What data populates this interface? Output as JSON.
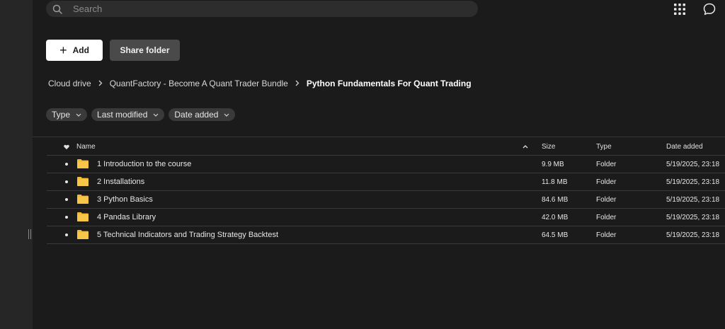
{
  "search": {
    "placeholder": "Search"
  },
  "toolbar": {
    "add_label": "Add",
    "share_label": "Share folder"
  },
  "breadcrumb": [
    "Cloud drive",
    "QuantFactory - Become A Quant Trader Bundle",
    "Python Fundamentals For Quant Trading"
  ],
  "filters": [
    "Type",
    "Last modified",
    "Date added"
  ],
  "table": {
    "columns": {
      "name": "Name",
      "size": "Size",
      "type": "Type",
      "date_added": "Date added"
    },
    "rows": [
      {
        "name": "1 Introduction to the course",
        "size": "9.9 MB",
        "type": "Folder",
        "date_added": "5/19/2025, 23:18"
      },
      {
        "name": "2 Installations",
        "size": "11.8 MB",
        "type": "Folder",
        "date_added": "5/19/2025, 23:18"
      },
      {
        "name": "3 Python Basics",
        "size": "84.6 MB",
        "type": "Folder",
        "date_added": "5/19/2025, 23:18"
      },
      {
        "name": "4 Pandas Library",
        "size": "42.0 MB",
        "type": "Folder",
        "date_added": "5/19/2025, 23:18"
      },
      {
        "name": "5 Technical Indicators and Trading Strategy Backtest",
        "size": "64.5 MB",
        "type": "Folder",
        "date_added": "5/19/2025, 23:18"
      }
    ]
  },
  "colors": {
    "background": "#1b1b1b",
    "sidebar": "#262626",
    "folder": "#f5b82e",
    "add_button": "#ffffff"
  },
  "icons": [
    "search-icon",
    "apps-grid-icon",
    "chat-icon",
    "plus-icon",
    "chevron-right-icon",
    "chevron-down-icon",
    "heart-icon",
    "sort-up-icon",
    "folder-icon"
  ]
}
